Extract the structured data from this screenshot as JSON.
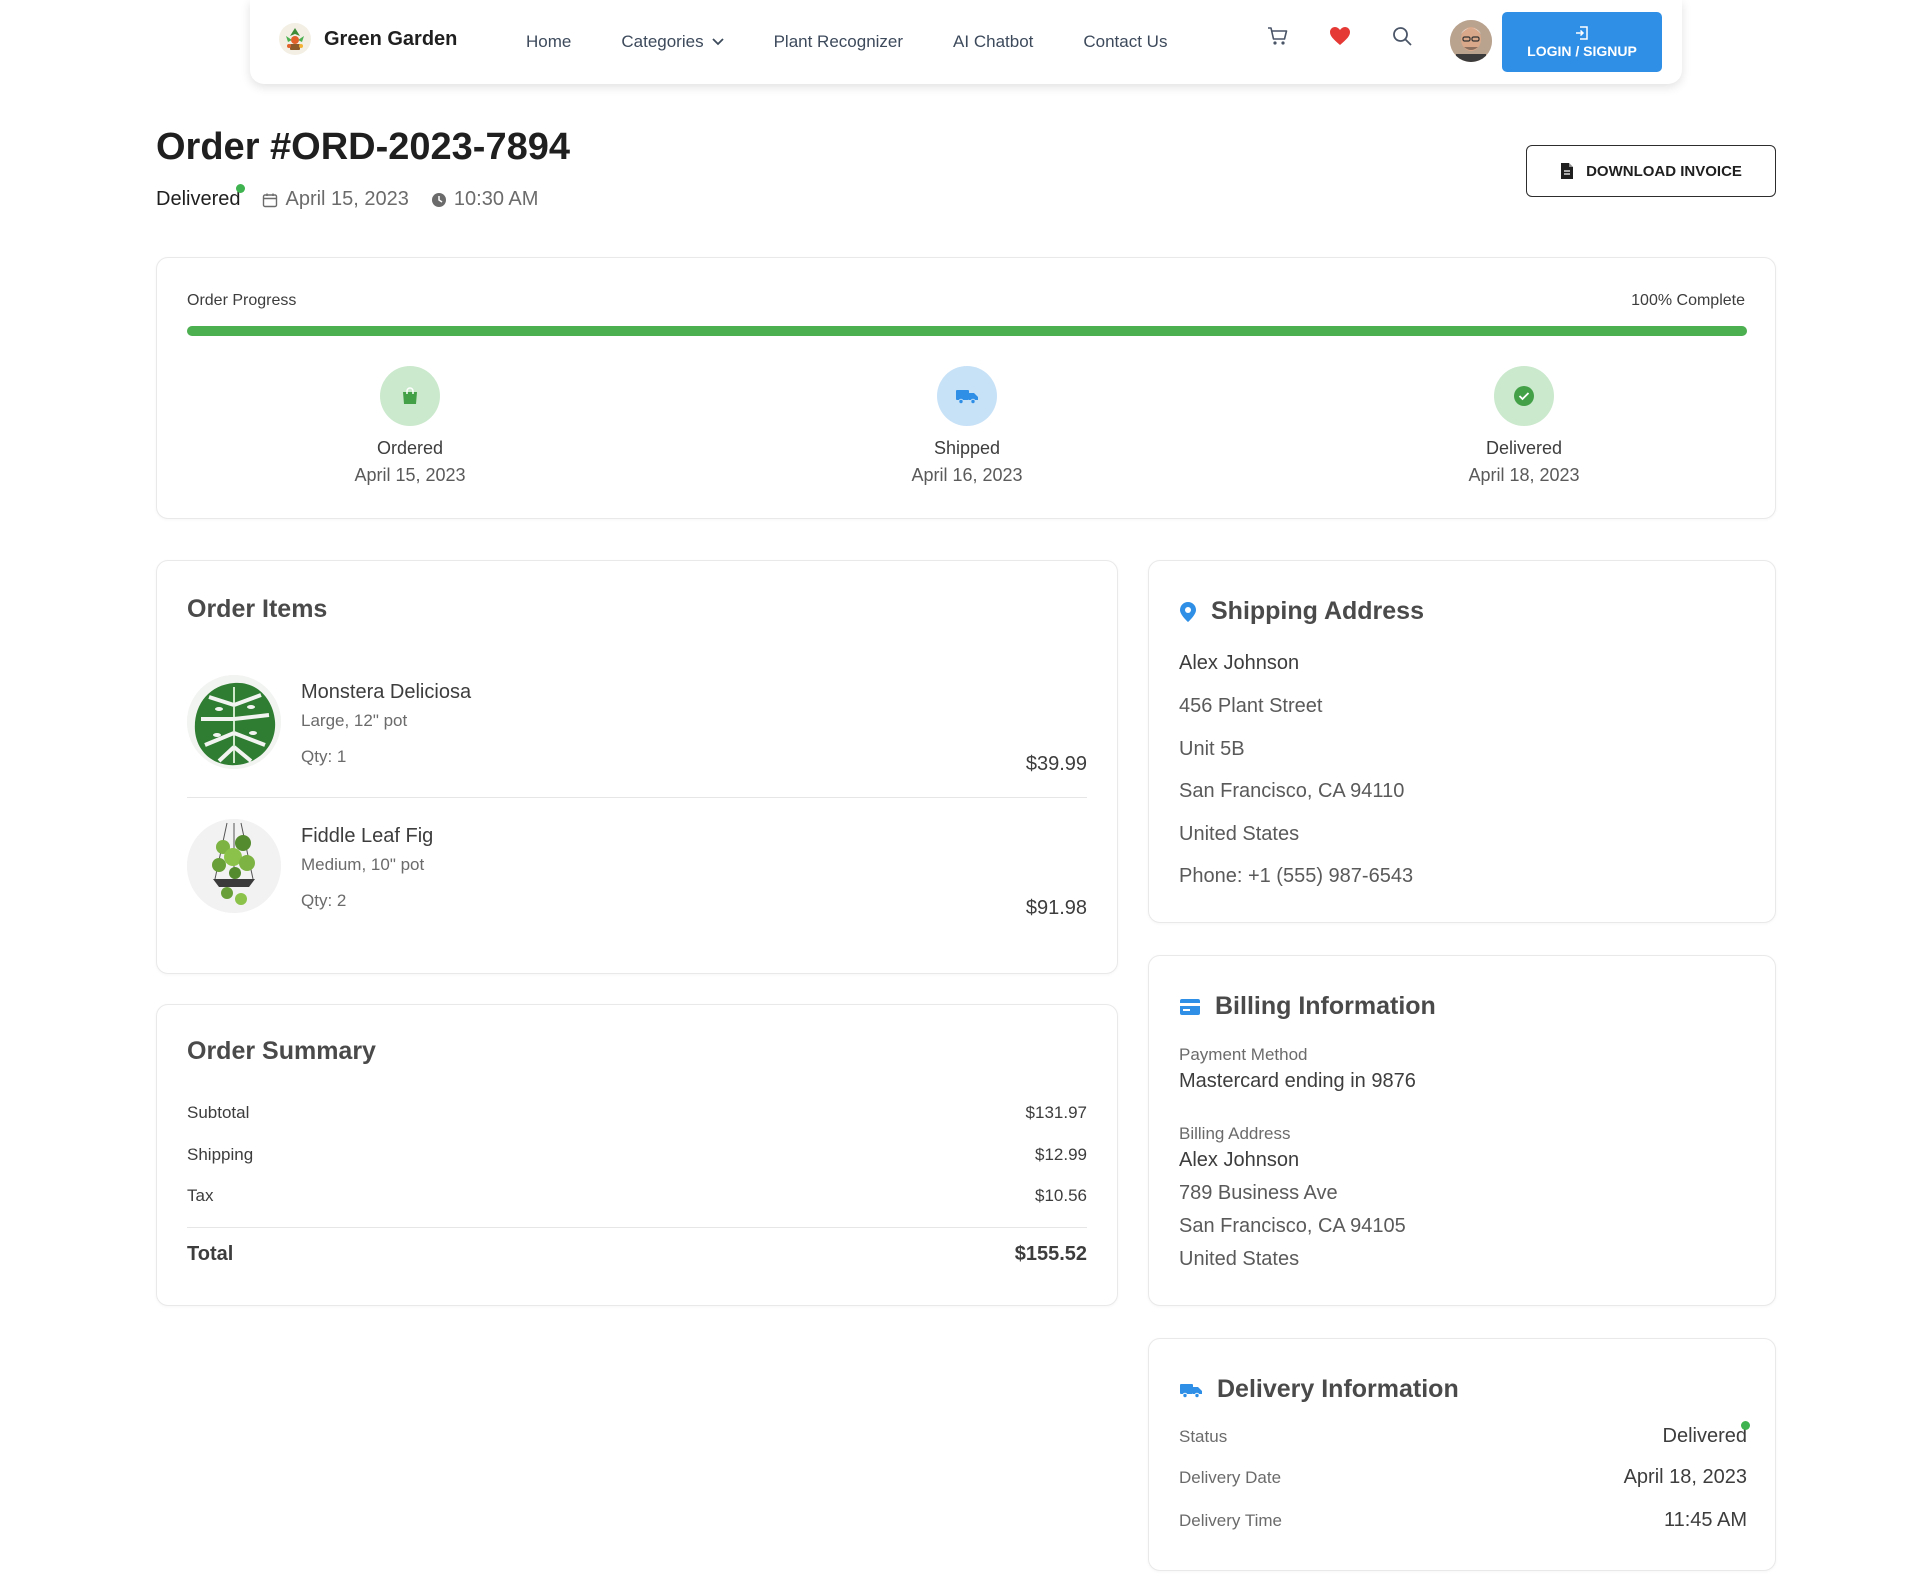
{
  "nav": {
    "brand": "Green Garden",
    "links": [
      "Home",
      "Categories",
      "Plant Recognizer",
      "AI Chatbot",
      "Contact Us"
    ],
    "login_label": "LOGIN / SIGNUP"
  },
  "header": {
    "order_title": "Order #ORD-2023-7894",
    "status": "Delivered",
    "date": "April 15, 2023",
    "time": "10:30 AM",
    "invoice_label": "DOWNLOAD INVOICE"
  },
  "progress": {
    "label": "Order Progress",
    "percent_label": "100% Complete",
    "percent": 100,
    "steps": [
      {
        "name": "Ordered",
        "date": "April 15, 2023"
      },
      {
        "name": "Shipped",
        "date": "April 16, 2023"
      },
      {
        "name": "Delivered",
        "date": "April 18, 2023"
      }
    ]
  },
  "items": {
    "title": "Order Items",
    "list": [
      {
        "name": "Monstera Deliciosa",
        "variant": "Large, 12\" pot",
        "qty": "Qty: 1",
        "price": "$39.99"
      },
      {
        "name": "Fiddle Leaf Fig",
        "variant": "Medium, 10\" pot",
        "qty": "Qty: 2",
        "price": "$91.98"
      }
    ]
  },
  "summary": {
    "title": "Order Summary",
    "subtotal_label": "Subtotal",
    "subtotal": "$131.97",
    "shipping_label": "Shipping",
    "shipping": "$12.99",
    "tax_label": "Tax",
    "tax": "$10.56",
    "total_label": "Total",
    "total": "$155.52"
  },
  "shipping": {
    "title": "Shipping Address",
    "lines": [
      "Alex Johnson",
      "456 Plant Street",
      "Unit 5B",
      "San Francisco, CA 94110",
      "United States",
      "Phone: +1 (555) 987-6543"
    ]
  },
  "billing": {
    "title": "Billing Information",
    "payment_label": "Payment Method",
    "payment": "Mastercard ending in 9876",
    "address_label": "Billing Address",
    "lines": [
      "Alex Johnson",
      "789 Business Ave",
      "San Francisco, CA 94105",
      "United States"
    ]
  },
  "delivery": {
    "title": "Delivery Information",
    "status_label": "Status",
    "status": "Delivered",
    "date_label": "Delivery Date",
    "date": "April 18, 2023",
    "time_label": "Delivery Time",
    "time": "11:45 AM"
  },
  "colors": {
    "primary_blue": "#2f8fe6",
    "success_green": "#4caf50",
    "heart_red": "#e53935"
  }
}
